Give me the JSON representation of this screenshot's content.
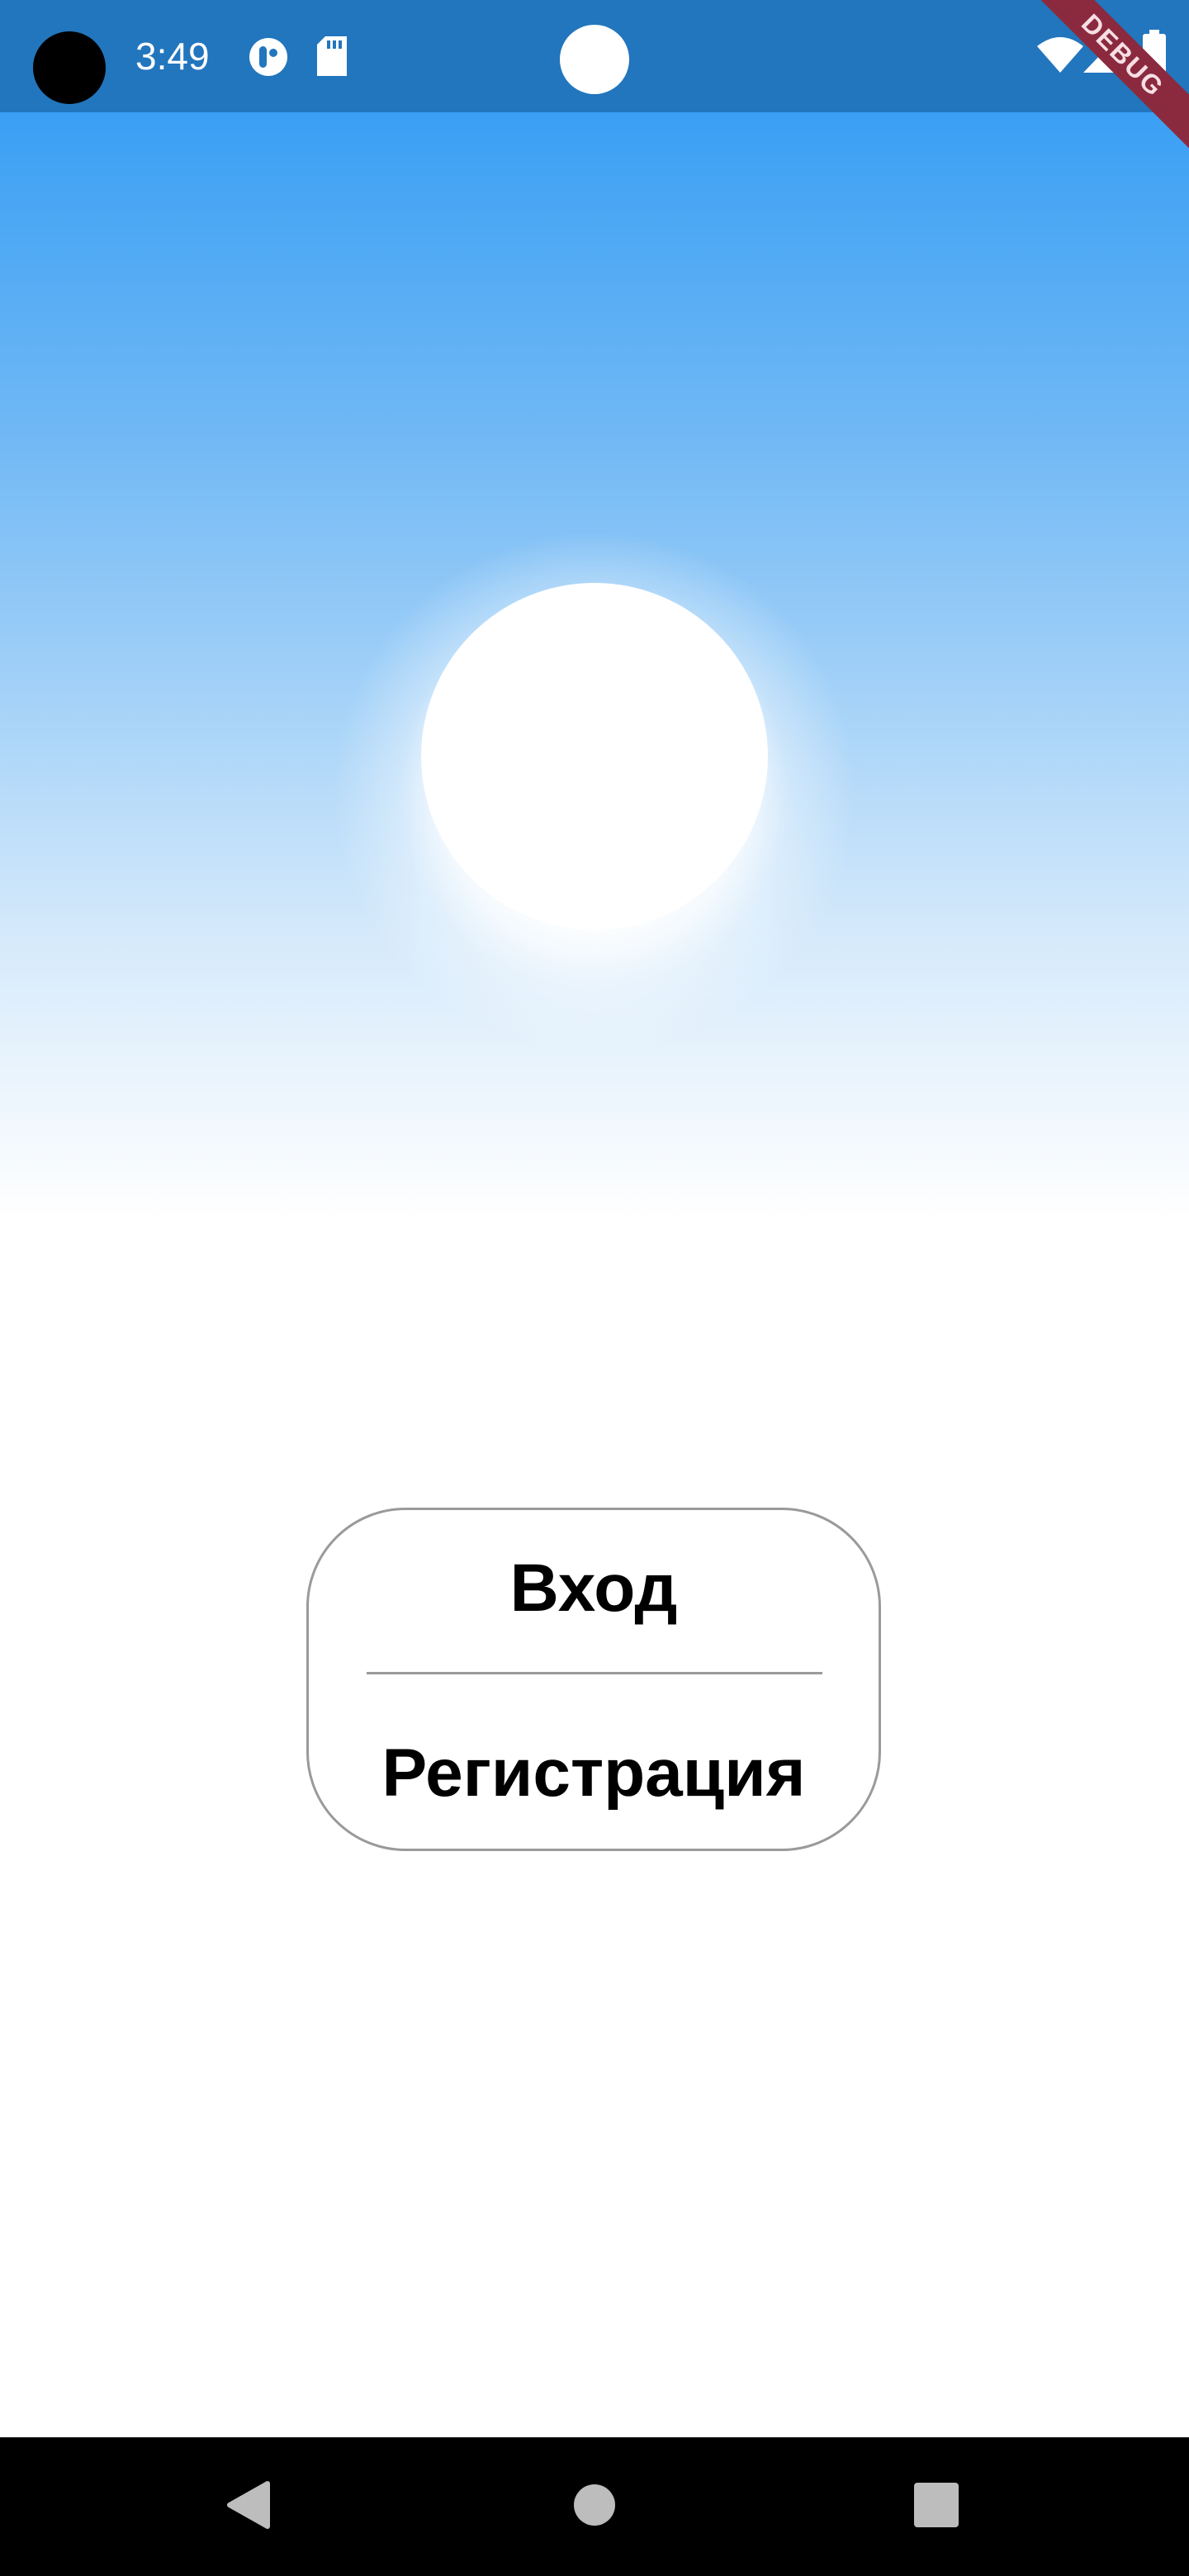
{
  "status_bar": {
    "time": "3:49",
    "bg_color": "#2276bd",
    "notification_icons": [
      "pill-app-icon",
      "sd-card-icon"
    ],
    "system_icons": [
      "wifi-icon",
      "cell-signal-icon",
      "battery-icon"
    ]
  },
  "debug_banner": {
    "label": "DEBUG",
    "color": "#8b2a3f"
  },
  "sky": {
    "top_color": "#3a9ff4",
    "bottom_color": "#ffffff"
  },
  "auth": {
    "login_label": "Вход",
    "register_label": "Регистрация",
    "border_color": "#9a9a9a"
  },
  "nav_bar": {
    "items": [
      "back-icon",
      "home-icon",
      "recents-icon"
    ]
  }
}
